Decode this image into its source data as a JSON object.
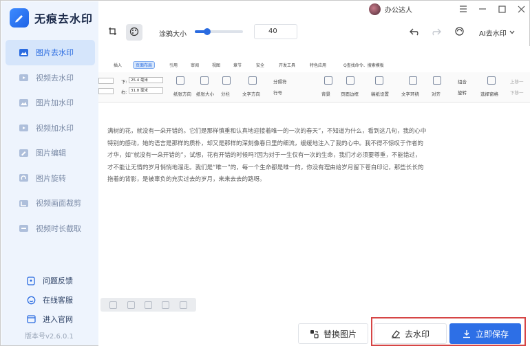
{
  "app": {
    "title": "无痕去水印",
    "version": "版本号v2.6.0.1"
  },
  "user": {
    "name": "办公达人"
  },
  "sidebar": {
    "items": [
      {
        "label": "图片去水印",
        "icon": "image-remove-icon",
        "active": true
      },
      {
        "label": "视频去水印",
        "icon": "video-remove-icon",
        "active": false
      },
      {
        "label": "图片加水印",
        "icon": "image-add-icon",
        "active": false
      },
      {
        "label": "视频加水印",
        "icon": "video-add-icon",
        "active": false
      },
      {
        "label": "图片编辑",
        "icon": "image-edit-icon",
        "active": false
      },
      {
        "label": "图片旋转",
        "icon": "image-rotate-icon",
        "active": false
      },
      {
        "label": "视频画面裁剪",
        "icon": "video-crop-icon",
        "active": false
      },
      {
        "label": "视频时长截取",
        "icon": "video-trim-icon",
        "active": false
      }
    ],
    "bottom": [
      {
        "label": "问题反馈",
        "icon": "feedback-icon"
      },
      {
        "label": "在线客服",
        "icon": "support-icon"
      },
      {
        "label": "进入官网",
        "icon": "website-icon"
      }
    ]
  },
  "toolbar": {
    "brush_label": "涂鸦大小",
    "brush_size": "40",
    "brush_fraction": 0.25,
    "ai_mode": "AI去水印"
  },
  "document": {
    "tabs": [
      "插入",
      "页面布局",
      "引用",
      "审阅",
      "视图",
      "章节",
      "安全",
      "开发工具",
      "特色应用",
      "Q查找命令、搜索模板"
    ],
    "active_tab": "页面布局",
    "ribbon": {
      "top_value": "25.4 毫米",
      "right_value": "31.8 毫米",
      "top_label": "下:",
      "right_label": "右:",
      "groups": [
        "纸张方向",
        "纸张大小",
        "分栏",
        "文字方向",
        "行号",
        "背景",
        "页面边框",
        "稿纸设置",
        "文字环绕",
        "对齐",
        "旋转",
        "选择窗格"
      ],
      "extra": [
        "分隔符",
        "组合",
        "上移一",
        "下移一"
      ]
    },
    "paragraph": [
      "满树的花，就没有一朵开错的。它们是那样慎重和认真地迎接着唯一的一次的春天”，不知道为什么，看到这几句，我的心中",
      "特别的感动，她的语言是那样的质朴，却又是那样的深刻像春日里的细流，缓缓地注入了我的心中。我不得不惊叹于作者的",
      "才华，如“就没有一朵开错的”，试想，花有开错的时候吗?因为对于一生仅有一次的生命，我们才必须要尊重，不能错过，",
      "才不能让无情的岁月悄悄地溜走。我们是“唯一”的，每一个生命都是唯一的，你没有理由给岁月留下苍白印记，那些长长的",
      "拖着的背影，是被辜负的充实过去的岁月，来来去去的路呀。"
    ]
  },
  "actions": {
    "replace": "替换图片",
    "remove": "去水印",
    "save": "立即保存"
  },
  "colors": {
    "accent": "#2d6fe6",
    "sidebar_bg": "#eef4fd",
    "highlight_border": "#d64545"
  }
}
